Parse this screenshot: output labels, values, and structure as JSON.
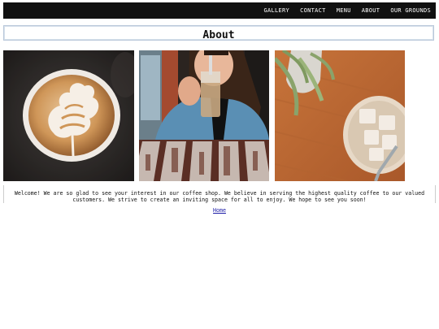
{
  "nav": {
    "items": [
      "GALLERY",
      "CONTACT",
      "MENU",
      "ABOUT",
      "OUR GROUNDS"
    ]
  },
  "page": {
    "title": "About"
  },
  "photos": [
    {
      "icon": "latte-art-photo"
    },
    {
      "icon": "woman-drinking-iced-coffee-photo"
    },
    {
      "icon": "iced-coffee-glass-photo"
    }
  ],
  "welcome": {
    "text": "Welcome! We are so glad to see your interest in our coffee shop. We believe in serving the highest quality coffee to our valued customers. We strive to create an inviting space for all to enjoy. We hope to see you soon!"
  },
  "footer": {
    "home_link": "Home"
  },
  "colors": {
    "navbar_bg": "#111111",
    "title_border": "#b9c8da",
    "link": "#1a1aa6"
  }
}
